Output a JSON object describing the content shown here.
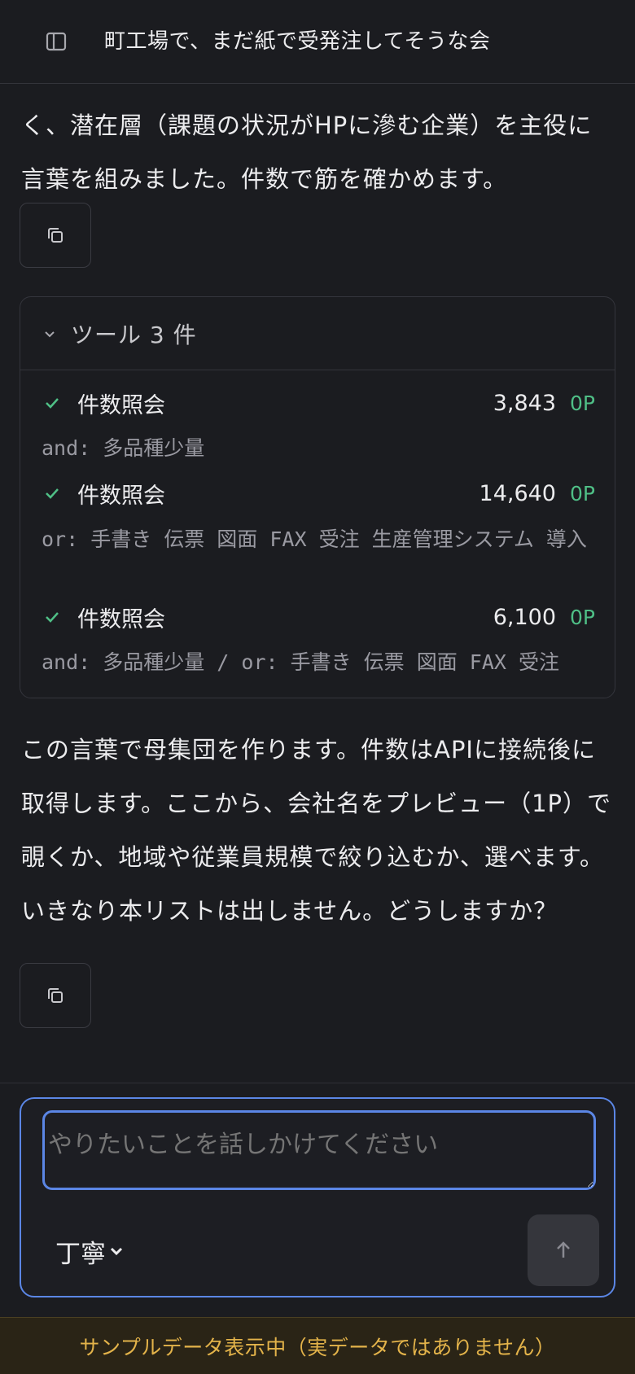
{
  "header": {
    "title": "町工場で、まだ紙で受発注してそうな会"
  },
  "messages": {
    "first_partial": "く、潜在層（課題の状況がHPに滲む企業）を主役に言葉を組みました。件数で筋を確かめます。",
    "second": "この言葉で母集団を作ります。件数はAPIに接続後に取得します。ここから、会社名をプレビュー（1P）で覗くか、地域や従業員規模で絞り込むか、選べます。いきなり本リストは出しません。どうしますか？"
  },
  "tools": {
    "summary": "ツール 3 件",
    "items": [
      {
        "name": "件数照会",
        "count": "3,843",
        "cost": "0P",
        "query": "and: 多品種少量"
      },
      {
        "name": "件数照会",
        "count": "14,640",
        "cost": "0P",
        "query": "or: 手書き 伝票 図面 FAX 受注 生産管理システム 導入"
      },
      {
        "name": "件数照会",
        "count": "6,100",
        "cost": "0P",
        "query": "and: 多品種少量 / or: 手書き 伝票 図面 FAX 受注"
      }
    ]
  },
  "composer": {
    "placeholder": "やりたいことを話しかけてください",
    "tone": "丁寧"
  },
  "banner": {
    "text": "サンプルデータ表示中（実データではありません）"
  },
  "colors": {
    "accent": "#5b86e5",
    "success": "#4fbf86",
    "warning": "#e3b34a",
    "background": "#1b1c20"
  },
  "icons": [
    "sidebar-toggle-icon",
    "copy-icon",
    "chevron-down-icon",
    "check-icon",
    "arrow-up-icon"
  ]
}
